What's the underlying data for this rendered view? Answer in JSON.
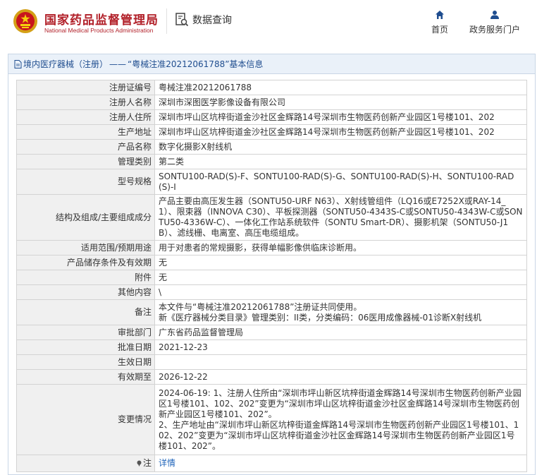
{
  "header": {
    "logo_cn": "国家药品监督管理局",
    "logo_en": "National Medical Products Administration",
    "query_label": "数据查询",
    "nav_home": "首页",
    "nav_gov": "政务服务门户"
  },
  "breadcrumb": {
    "section": "境内医疗器械（注册）",
    "separator": "——",
    "record": "“粤械注准20212061788”基本信息"
  },
  "rows": [
    {
      "label": "注册证编号",
      "value": "粤械注准20212061788"
    },
    {
      "label": "注册人名称",
      "value": "深圳市深图医学影像设备有限公司"
    },
    {
      "label": "注册人住所",
      "value": "深圳市坪山区坑梓街道金沙社区金辉路14号深圳市生物医药创新产业园区1号楼101、202"
    },
    {
      "label": "生产地址",
      "value": "深圳市坪山区坑梓街道金沙社区金辉路14号深圳市生物医药创新产业园区1号楼101、202"
    },
    {
      "label": "产品名称",
      "value": "数字化摄影X射线机"
    },
    {
      "label": "管理类别",
      "value": "第二类"
    },
    {
      "label": "型号规格",
      "value": "SONTU100-RAD(S)-F、SONTU100-RAD(S)-G、SONTU100-RAD(S)-H、SONTU100-RAD(S)-I"
    },
    {
      "label": "结构及组成/主要组成成分",
      "value": "产品主要由高压发生器（SONTU50-URF N63）、X射线管组件（LQ16或E7252X或RAY-14_1）、限束器（INNOVA C30）、平板探测器（SONTU50-4343S-C或SONTU50-4343W-C或SONTU50-4336W-C）、一体化工作站系统软件（SONTU Smart-DR）、摄影机架（SONTU50-J1B）、滤线栅、电离室、高压电缆组成。"
    },
    {
      "label": "适用范围/预期用途",
      "value": "用于对患者的常规摄影，获得单幅影像供临床诊断用。"
    },
    {
      "label": "产品储存条件及有效期",
      "value": "无"
    },
    {
      "label": "附件",
      "value": "无"
    },
    {
      "label": "其他内容",
      "value": "\\"
    },
    {
      "label": "备注",
      "value_lines": [
        "本文件与“粤械注准20212061788”注册证共同使用。",
        "新《医疗器械分类目录》管理类别：II类，分类编码：06医用成像器械-01诊断X射线机"
      ]
    },
    {
      "label": "审批部门",
      "value": "广东省药品监督管理局"
    },
    {
      "label": "批准日期",
      "value": "2021-12-23"
    },
    {
      "label": "生效日期",
      "value": ""
    },
    {
      "label": "有效期至",
      "value": "2026-12-22"
    },
    {
      "label": "变更情况",
      "value_lines": [
        "2024-06-19: 1、注册人住所由“深圳市坪山新区坑梓街道金辉路14号深圳市生物医药创新产业园区1号楼101、102、202”变更为“深圳市坪山区坑梓街道金沙社区金辉路14号深圳市生物医药创新产业园区1号楼101、202”。",
        "2、生产地址由“深圳市坪山新区坑梓街道金辉路14号深圳市生物医药创新产业园区1号楼101、102、202”变更为“深圳市坪山区坑梓街道金沙社区金辉路14号深圳市生物医药创新产业园区1号楼101、202”。"
      ]
    },
    {
      "label": "注",
      "value": "详情"
    }
  ],
  "colors": {
    "brand": "#b2212a",
    "link": "#2266bb",
    "label_bg": "#f0f0f0",
    "panel_head_bg": "#eaf1f9"
  }
}
